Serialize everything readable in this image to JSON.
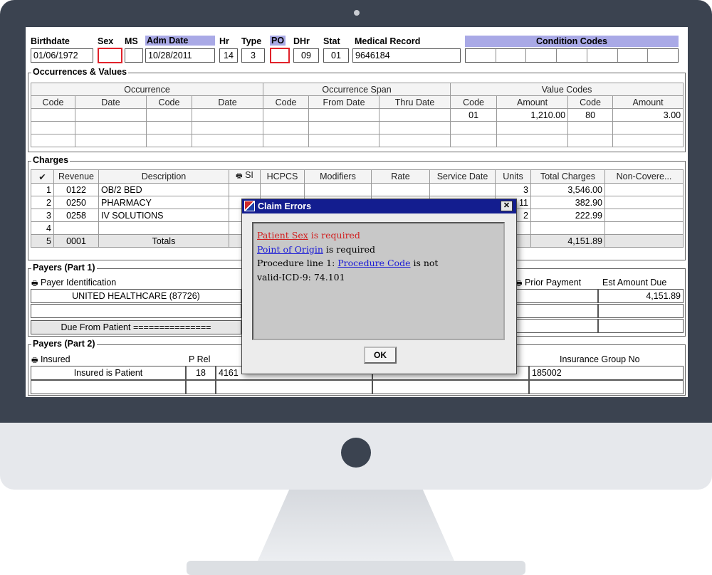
{
  "header": {
    "labels": {
      "birthdate": "Birthdate",
      "sex": "Sex",
      "ms": "MS",
      "adm_date": "Adm Date",
      "hr": "Hr",
      "type": "Type",
      "po": "PO",
      "dhr": "DHr",
      "stat": "Stat",
      "medical_record": "Medical Record",
      "condition_codes": "Condition Codes"
    },
    "values": {
      "birthdate": "01/06/1972",
      "sex": "",
      "ms": "",
      "adm_date": "10/28/2011",
      "hr": "14",
      "type": "3",
      "po": "",
      "dhr": "09",
      "stat": "01",
      "medical_record": "9646184"
    }
  },
  "occurrences": {
    "title": "Occurrences & Values",
    "groups": [
      "Occurrence",
      "Occurrence Span",
      "Value Codes"
    ],
    "columns": [
      "Code",
      "Date",
      "Code",
      "Date",
      "Code",
      "From Date",
      "Thru Date",
      "Code",
      "Amount",
      "Code",
      "Amount"
    ],
    "value_codes": [
      {
        "code1": "01",
        "amount1": "1,210.00",
        "code2": "80",
        "amount2": "3.00"
      }
    ]
  },
  "charges": {
    "title": "Charges",
    "columns": {
      "check": "✔",
      "revenue": "Revenue",
      "description": "Description",
      "si": "SI",
      "hcpcs": "HCPCS",
      "modifiers": "Modifiers",
      "rate": "Rate",
      "service_date": "Service Date",
      "units": "Units",
      "total_charges": "Total Charges",
      "non_covered": "Non-Covere..."
    },
    "rows": [
      {
        "num": "1",
        "revenue": "0122",
        "description": "OB/2 BED",
        "units": "3",
        "total": "3,546.00"
      },
      {
        "num": "2",
        "revenue": "0250",
        "description": "PHARMACY",
        "units": "11",
        "total": "382.90"
      },
      {
        "num": "3",
        "revenue": "0258",
        "description": "IV SOLUTIONS",
        "units": "2",
        "total": "222.99"
      },
      {
        "num": "4",
        "revenue": "",
        "description": "",
        "units": "",
        "total": ""
      }
    ],
    "totals": {
      "num": "5",
      "revenue": "0001",
      "label": "Totals",
      "total": "4,151.89"
    }
  },
  "payers1": {
    "title": "Payers (Part 1)",
    "payer_id_label": "Payer Identification",
    "payer": "UNITED HEALTHCARE (87726)",
    "due_from_patient": "Due From Patient ===============",
    "prior_payment_label": "Prior Payment",
    "est_amount_label": "Est Amount Due",
    "est_amount": "4,151.89"
  },
  "payers2": {
    "title": "Payers (Part 2)",
    "insured_label": "Insured",
    "p_rel_label": "P Rel",
    "insured_value": "Insured is Patient",
    "p_rel_value": "18",
    "id_partial": "4161",
    "group_no_label": "Insurance Group No",
    "group_no": "185002"
  },
  "dialog": {
    "title": "Claim Errors",
    "close": "✕",
    "line1_link": "Patient Sex",
    "line1_rest": " is required",
    "line2_link": "Point of Origin",
    "line2_rest": " is required",
    "line3_prefix": "Procedure line 1: ",
    "line3_link": "Procedure Code",
    "line3_rest": " is not",
    "line4": "valid-ICD-9: 74.101",
    "ok": "OK"
  }
}
